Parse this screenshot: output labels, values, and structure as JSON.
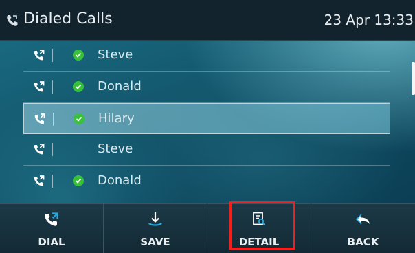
{
  "header": {
    "title": "Dialed Calls",
    "datetime": "23 Apr 13:33",
    "icon": "dialed-calls-icon"
  },
  "call_list": [
    {
      "name": "Steve",
      "verified": true,
      "selected": false
    },
    {
      "name": "Donald",
      "verified": true,
      "selected": false
    },
    {
      "name": "Hilary",
      "verified": true,
      "selected": true
    },
    {
      "name": "Steve",
      "verified": false,
      "selected": false
    },
    {
      "name": "Donald",
      "verified": true,
      "selected": false
    }
  ],
  "softkeys": [
    {
      "label": "DIAL",
      "icon": "dial-icon"
    },
    {
      "label": "SAVE",
      "icon": "save-icon"
    },
    {
      "label": "DETAIL",
      "icon": "detail-icon"
    },
    {
      "label": "BACK",
      "icon": "back-icon"
    }
  ],
  "colors": {
    "header_bg": "#13232d",
    "check": "#39c13c",
    "highlight_box": "#f21f1f"
  }
}
